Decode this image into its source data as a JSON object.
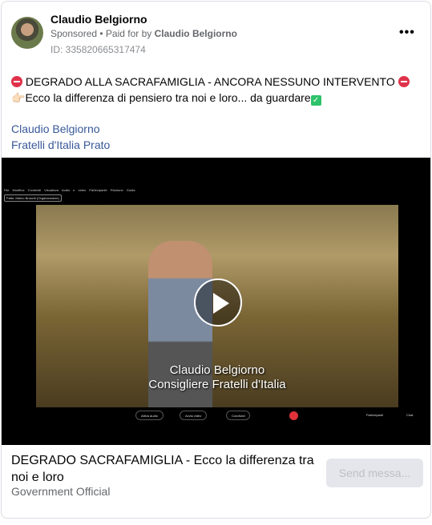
{
  "header": {
    "name": "Claudio Belgiorno",
    "sponsored": "Sponsored",
    "paid_for_prefix": " • Paid for by ",
    "paid_for_by": "Claudio Belgiorno",
    "id": "ID: 335820665317474",
    "more": "•••"
  },
  "body": {
    "line1": " DEGRADO ALLA SACRAFAMIGLIA - ANCORA NESSUNO INTERVENTO ",
    "line2_emoji": "👉🏻",
    "line2": "Ecco la differenza di pensiero tra noi e loro... da guardare",
    "link1": "Claudio Belgiorno",
    "link2": "Fratelli d'Italia Prato"
  },
  "video": {
    "menu": "File Modifica Condividi Visualizza Audio e video Partecipante Riunione Guida",
    "tag": "Fatto: Marco Bruschi (Organizzatore)",
    "caption1": "Claudio Belgiorno",
    "caption2": "Consigliere Fratelli d'Italia",
    "mute": "Attiva audio",
    "start_video": "Avvia video",
    "share": "Condividi",
    "participants": "Partecipanti",
    "chat": "Chat"
  },
  "footer": {
    "title": "DEGRADO SACRAFAMIGLIA - Ecco la differenza tra noi e loro",
    "subtitle": "Government Official",
    "button": "Send messa..."
  }
}
